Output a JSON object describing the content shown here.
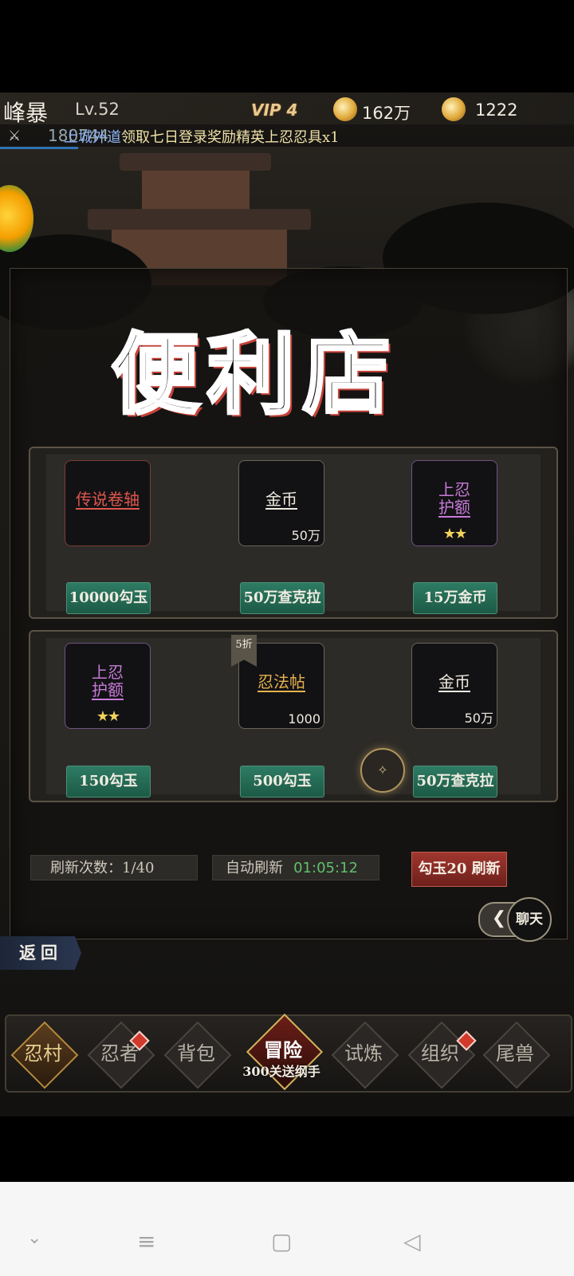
{
  "hud": {
    "player_name": "峰暴",
    "level": "Lv.52",
    "vip": "VIP 4",
    "coins": "162万",
    "gouyu": "1222",
    "power": "180744",
    "ticker_sys": "上城外道",
    "ticker_msg": "领取七日登录奖励精英上忍忍具x1"
  },
  "shop": {
    "title": "便利店",
    "shelf1": [
      {
        "name": "传说卷轴",
        "name_color": "#e0574c",
        "qty": "",
        "stars": "",
        "price": "10000勾玉"
      },
      {
        "name": "金币",
        "name_color": "#f0ebe0",
        "qty": "50万",
        "stars": "",
        "price": "50万查克拉"
      },
      {
        "name_line1": "上忍",
        "name_line2": "护额",
        "name_color": "#c87ad8",
        "qty": "",
        "stars": "★★",
        "price": "15万金币"
      }
    ],
    "shelf2": [
      {
        "name_line1": "上忍",
        "name_line2": "护额",
        "name_color": "#c87ad8",
        "qty": "",
        "stars": "★★",
        "price": "150勾玉"
      },
      {
        "name": "忍法帖",
        "name_color": "#e7b24d",
        "qty": "1000",
        "stars": "",
        "price": "500勾玉",
        "discount": "5折"
      },
      {
        "name": "金币",
        "name_color": "#f0ebe0",
        "qty": "50万",
        "stars": "",
        "price": "50万查克拉"
      }
    ],
    "refresh_count_label": "刷新次数：1/40",
    "auto_refresh_label": "自动刷新",
    "auto_refresh_timer": "01:05:12",
    "refresh_button": "勾玉20 刷新"
  },
  "chat_label": "聊天",
  "back_label": "返回",
  "nav": {
    "items": [
      "忍村",
      "忍者",
      "背包",
      "冒险",
      "试炼",
      "组织",
      "尾兽"
    ],
    "adventure_sub": "300关送纲手"
  },
  "system_icons": [
    "chevron-down-icon",
    "menu-icon",
    "home-square-icon",
    "back-triangle-icon"
  ]
}
